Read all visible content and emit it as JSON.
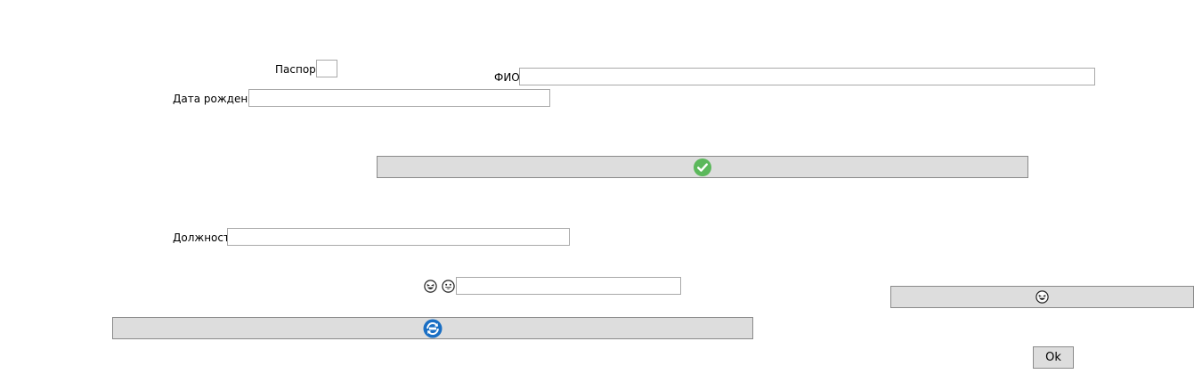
{
  "form": {
    "passport_label": "Паспорт",
    "passport_value": "",
    "fio_label": "ФИО",
    "fio_value": "",
    "birthdate_label": "Дата рождения",
    "birthdate_value": "",
    "position_label": "Должность",
    "position_value": "",
    "emoji_field_value": ""
  },
  "buttons": {
    "confirm_icon": "checkmark-circle-icon",
    "refresh_icon": "refresh-circle-icon",
    "laugh_icon": "laughing-face-icon",
    "ok_label": "Ok"
  },
  "emoji_row": {
    "first_icon": "laughing-face-icon",
    "second_icon": "grinning-face-icon"
  },
  "colors": {
    "button_bg": "#dddddd",
    "input_border": "#a9a9a9",
    "confirm_green": "#5cb85c",
    "refresh_blue": "#1a6fc4"
  }
}
